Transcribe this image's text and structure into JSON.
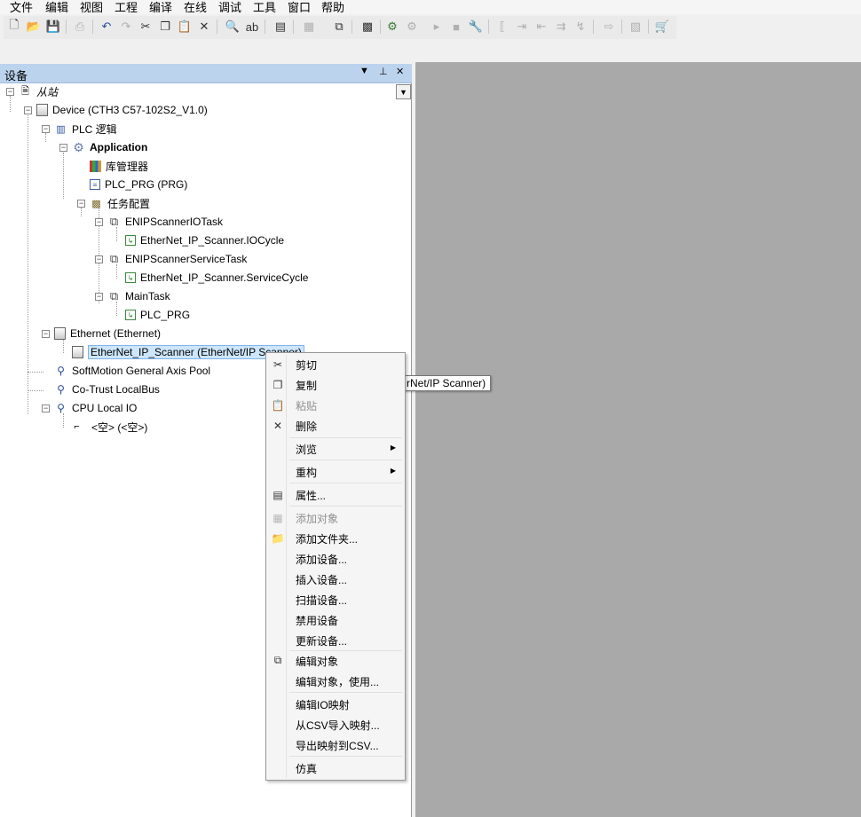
{
  "menubar": [
    "文件",
    "编辑",
    "视图",
    "工程",
    "编译",
    "在线",
    "调试",
    "工具",
    "窗口",
    "帮助"
  ],
  "toolbar_icons": [
    "new-file-icon",
    "open-folder-icon",
    "save-icon",
    "print-icon",
    "undo-icon",
    "redo-icon",
    "cut-icon",
    "copy-icon",
    "paste-icon",
    "delete-icon",
    "find-icon",
    "replace-icon",
    "properties-icon",
    "add-object-icon",
    "edit-object-icon",
    "build-icon",
    "login-icon",
    "logout-icon",
    "run-icon",
    "stop-icon",
    "reset-icon",
    "breakpoint-icon",
    "step-over-icon",
    "step-into-icon",
    "step-out-icon",
    "cursor-icon",
    "next-statement-icon",
    "force-icon",
    "write-icon",
    "cart-icon"
  ],
  "panel": {
    "title": "设备",
    "pin": "⊥",
    "close": "✕",
    "menu": "▼"
  },
  "tree": {
    "root": "从站",
    "device": "Device (CTH3 C57-102S2_V1.0)",
    "plc_logic": "PLC 逻辑",
    "application": "Application",
    "library_manager": "库管理器",
    "plc_prg": "PLC_PRG (PRG)",
    "task_config": "任务配置",
    "task1": "ENIPScannerIOTask",
    "task1_call": "EtherNet_IP_Scanner.IOCycle",
    "task2": "ENIPScannerServiceTask",
    "task2_call": "EtherNet_IP_Scanner.ServiceCycle",
    "task3": "MainTask",
    "task3_call": "PLC_PRG",
    "ethernet": "Ethernet (Ethernet)",
    "scanner": "EtherNet_IP_Scanner (EtherNet/IP Scanner)",
    "softmotion": "SoftMotion General Axis Pool",
    "cotrust": "Co-Trust LocalBus",
    "cpu_io": "CPU Local IO",
    "empty": "<空> (<空>)"
  },
  "tooltip": "rNet/IP Scanner)",
  "context_menu": {
    "cut": "剪切",
    "copy": "复制",
    "paste": "粘贴",
    "delete": "删除",
    "browse": "浏览",
    "refactor": "重构",
    "properties": "属性...",
    "add_object": "添加对象",
    "add_folder": "添加文件夹...",
    "add_device": "添加设备...",
    "insert_device": "插入设备...",
    "scan_device": "扫描设备...",
    "disable_device": "禁用设备",
    "update_device": "更新设备...",
    "edit_object": "编辑对象",
    "edit_object_with": "编辑对象，使用...",
    "edit_io_mapping": "编辑IO映射",
    "import_csv": "从CSV导入映射...",
    "export_csv": "导出映射到CSV...",
    "simulation": "仿真"
  }
}
